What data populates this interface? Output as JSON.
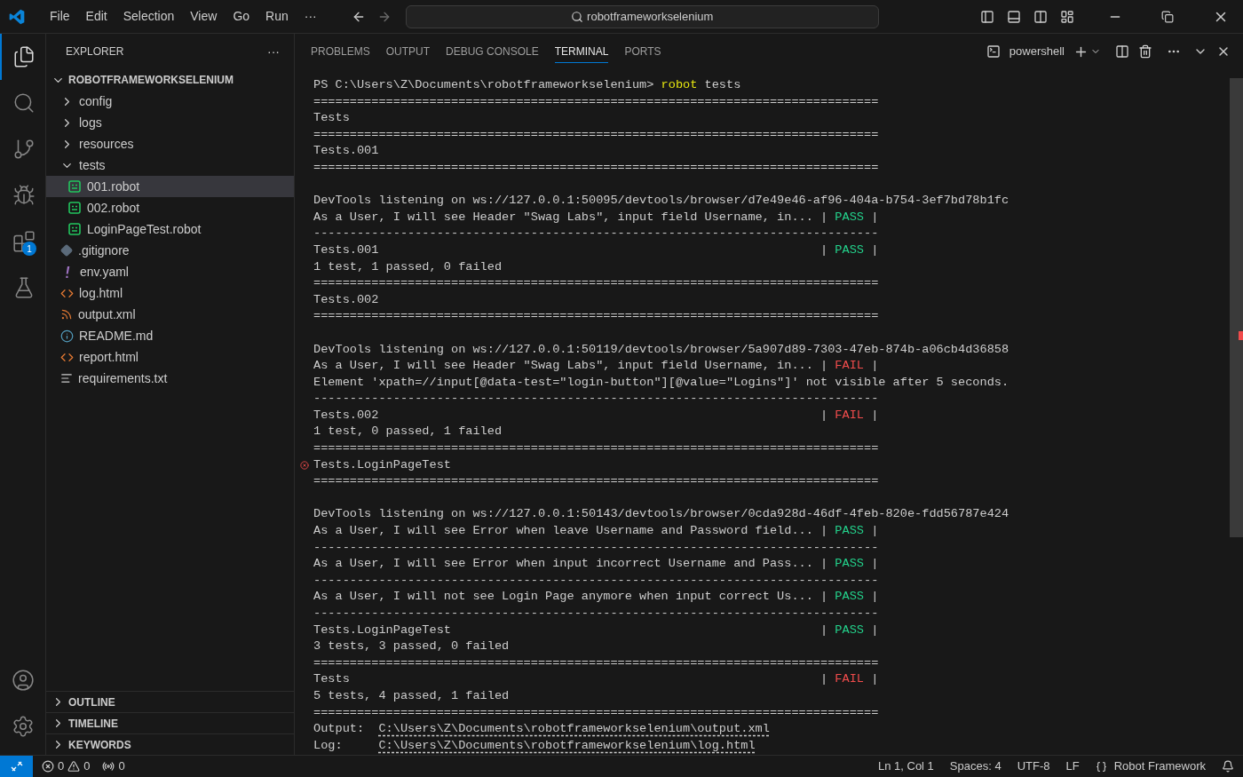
{
  "titlebar": {
    "menus": [
      "File",
      "Edit",
      "Selection",
      "View",
      "Go",
      "Run",
      "···"
    ],
    "search": "robotframeworkselenium"
  },
  "activity": [
    {
      "kind": "files",
      "selected": true
    },
    {
      "kind": "search",
      "selected": false
    },
    {
      "kind": "scm",
      "selected": false
    },
    {
      "kind": "debug",
      "selected": false
    },
    {
      "kind": "extensions",
      "selected": false,
      "badge": "1"
    },
    {
      "kind": "testing",
      "selected": false
    }
  ],
  "activity_bottom": [
    {
      "kind": "account"
    },
    {
      "kind": "settings"
    }
  ],
  "sidebar": {
    "title": "EXPLORER",
    "more": "···",
    "root": {
      "label": "ROBOTFRAMEWORKSELENIUM",
      "expanded": true,
      "children": [
        {
          "label": "config",
          "kind": "folder",
          "expanded": false,
          "selected": false
        },
        {
          "label": "logs",
          "kind": "folder",
          "expanded": false,
          "selected": false
        },
        {
          "label": "resources",
          "kind": "folder",
          "expanded": false,
          "selected": false
        },
        {
          "label": "tests",
          "kind": "folder",
          "expanded": true,
          "selected": false,
          "children": [
            {
              "label": "001.robot",
              "kind": "robot",
              "selected": true
            },
            {
              "label": "002.robot",
              "kind": "robot",
              "selected": false
            },
            {
              "label": "LoginPageTest.robot",
              "kind": "robot",
              "selected": false
            }
          ]
        },
        {
          "label": ".gitignore",
          "kind": "git",
          "selected": false
        },
        {
          "label": "env.yaml",
          "kind": "yaml",
          "selected": false
        },
        {
          "label": "log.html",
          "kind": "html",
          "selected": false
        },
        {
          "label": "output.xml",
          "kind": "rss",
          "selected": false
        },
        {
          "label": "README.md",
          "kind": "info",
          "selected": false
        },
        {
          "label": "report.html",
          "kind": "html",
          "selected": false
        },
        {
          "label": "requirements.txt",
          "kind": "lines",
          "selected": false
        }
      ]
    },
    "sections": [
      {
        "label": "OUTLINE",
        "expanded": false
      },
      {
        "label": "TIMELINE",
        "expanded": false
      },
      {
        "label": "KEYWORDS",
        "expanded": false
      }
    ]
  },
  "panel": {
    "tabs": [
      {
        "label": "PROBLEMS",
        "selected": false
      },
      {
        "label": "OUTPUT",
        "selected": false
      },
      {
        "label": "DEBUG CONSOLE",
        "selected": false
      },
      {
        "label": "TERMINAL",
        "selected": true
      },
      {
        "label": "PORTS",
        "selected": false
      }
    ],
    "shell": "powershell"
  },
  "terminal": [
    {
      "kind": "prompt",
      "text": "PS C:\\Users\\Z\\Documents\\robotframeworkselenium> ",
      "command": "robot",
      "args": " tests"
    },
    {
      "kind": "text",
      "text": "=============================================================================="
    },
    {
      "kind": "text",
      "text": "Tests"
    },
    {
      "kind": "text",
      "text": "=============================================================================="
    },
    {
      "kind": "text",
      "text": "Tests.001"
    },
    {
      "kind": "text",
      "text": "=============================================================================="
    },
    {
      "kind": "blank"
    },
    {
      "kind": "text",
      "text": "DevTools listening on ws://127.0.0.1:50095/devtools/browser/d7e49e46-af96-404a-b754-3ef7bd78b1fc"
    },
    {
      "kind": "result",
      "text": "As a User, I will see Header \"Swag Labs\", input field Username, in...",
      "open": "|",
      "status": "PASS",
      "close": "|",
      "passed": true
    },
    {
      "kind": "text",
      "text": "------------------------------------------------------------------------------"
    },
    {
      "kind": "result",
      "text": "Tests.001",
      "open": "|",
      "status": "PASS",
      "close": "|",
      "passed": true
    },
    {
      "kind": "text",
      "text": "1 test, 1 passed, 0 failed"
    },
    {
      "kind": "text",
      "text": "=============================================================================="
    },
    {
      "kind": "text",
      "text": "Tests.002"
    },
    {
      "kind": "text",
      "text": "=============================================================================="
    },
    {
      "kind": "blank"
    },
    {
      "kind": "text",
      "text": "DevTools listening on ws://127.0.0.1:50119/devtools/browser/5a907d89-7303-47eb-874b-a06cb4d36858"
    },
    {
      "kind": "result",
      "text": "As a User, I will see Header \"Swag Labs\", input field Username, in...",
      "open": "|",
      "status": "FAIL",
      "close": "|",
      "passed": false
    },
    {
      "kind": "text",
      "text": "Element 'xpath=//input[@data-test=\"login-button\"][@value=\"Logins\"]' not visible after 5 seconds."
    },
    {
      "kind": "text",
      "text": "------------------------------------------------------------------------------"
    },
    {
      "kind": "result",
      "text": "Tests.002",
      "open": "|",
      "status": "FAIL",
      "close": "|",
      "passed": false
    },
    {
      "kind": "text",
      "text": "1 test, 0 passed, 1 failed"
    },
    {
      "kind": "text",
      "text": "=============================================================================="
    },
    {
      "kind": "text",
      "text": "Tests.LoginPageTest",
      "error_mark": true
    },
    {
      "kind": "text",
      "text": "=============================================================================="
    },
    {
      "kind": "blank"
    },
    {
      "kind": "text",
      "text": "DevTools listening on ws://127.0.0.1:50143/devtools/browser/0cda928d-46df-4feb-820e-fdd56787e424"
    },
    {
      "kind": "result",
      "text": "As a User, I will see Error when leave Username and Password field...",
      "open": "|",
      "status": "PASS",
      "close": "|",
      "passed": true
    },
    {
      "kind": "text",
      "text": "------------------------------------------------------------------------------"
    },
    {
      "kind": "result",
      "text": "As a User, I will see Error when input incorrect Username and Pass...",
      "open": "|",
      "status": "PASS",
      "close": "|",
      "passed": true
    },
    {
      "kind": "text",
      "text": "------------------------------------------------------------------------------"
    },
    {
      "kind": "result",
      "text": "As a User, I will not see Login Page anymore when input correct Us...",
      "open": "|",
      "status": "PASS",
      "close": "|",
      "passed": true
    },
    {
      "kind": "text",
      "text": "------------------------------------------------------------------------------"
    },
    {
      "kind": "result",
      "text": "Tests.LoginPageTest",
      "open": "|",
      "status": "PASS",
      "close": "|",
      "passed": true
    },
    {
      "kind": "text",
      "text": "3 tests, 3 passed, 0 failed"
    },
    {
      "kind": "text",
      "text": "=============================================================================="
    },
    {
      "kind": "result",
      "text": "Tests",
      "open": "|",
      "status": "FAIL",
      "close": "|",
      "passed": false
    },
    {
      "kind": "text",
      "text": "5 tests, 4 passed, 1 failed"
    },
    {
      "kind": "text",
      "text": "=============================================================================="
    },
    {
      "kind": "link",
      "label": "Output:",
      "path": "C:\\Users\\Z\\Documents\\robotframeworkselenium\\output.xml"
    },
    {
      "kind": "link",
      "label": "Log:",
      "path": "C:\\Users\\Z\\Documents\\robotframeworkselenium\\log.html"
    }
  ],
  "statusbar": {
    "errors": "0",
    "warnings": "0",
    "ports": "0",
    "right": [
      "Ln 1, Col 1",
      "Spaces: 4",
      "UTF-8",
      "LF"
    ],
    "language": "Robot Framework"
  }
}
